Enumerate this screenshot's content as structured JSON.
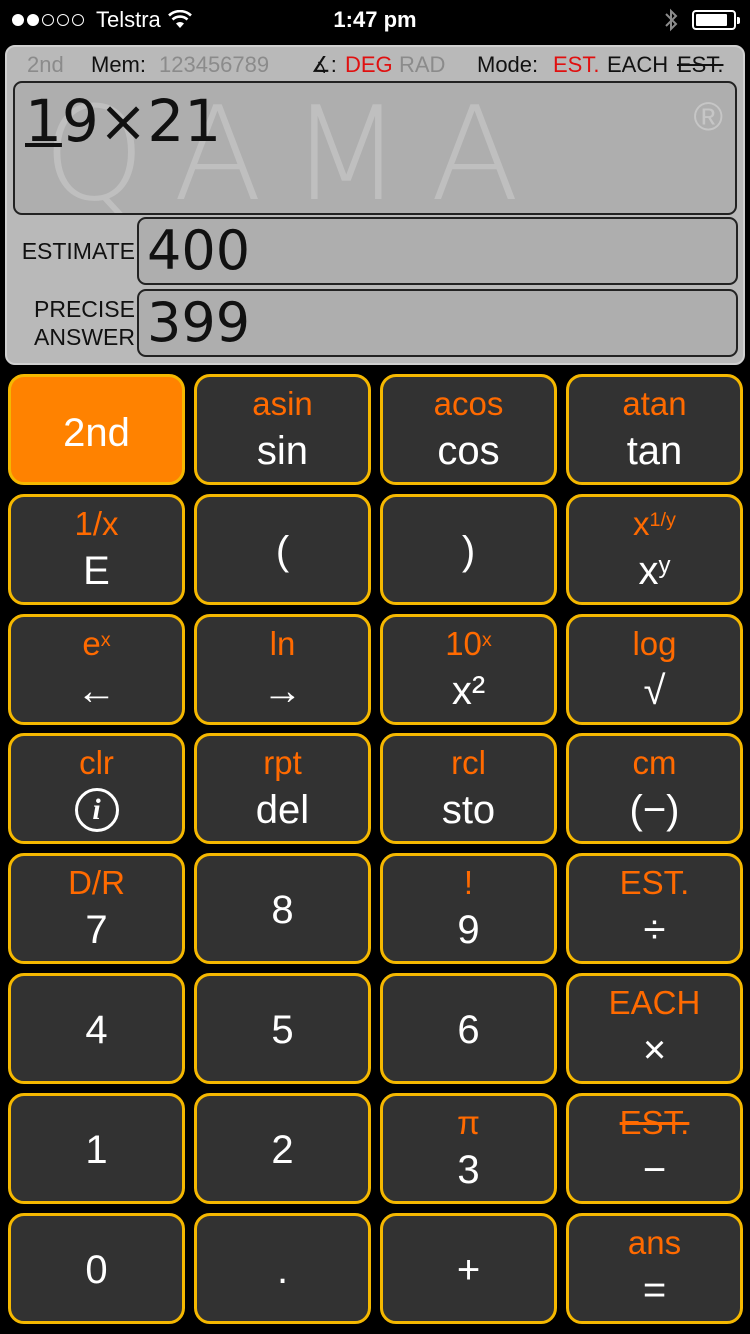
{
  "status_bar": {
    "carrier": "Telstra",
    "signal_dots_filled": 2,
    "signal_dots_total": 5,
    "time": "1:47 pm",
    "battery_level": 0.85
  },
  "info_bar": {
    "second_indicator": "2nd",
    "mem_label": "Mem:",
    "mem_value": "123456789",
    "angle_label": "∡:",
    "angle_deg": "DEG",
    "angle_rad": "RAD",
    "mode_label": "Mode:",
    "mode_est": "EST.",
    "mode_each": "EACH",
    "mode_est_struck": "EST."
  },
  "display": {
    "watermark": "QAMA",
    "watermark_mark": "®",
    "expression_cursor": "1",
    "expression_rest": "9×21",
    "estimate_label": "ESTIMATE",
    "estimate_value": "400",
    "precise_label_1": "PRECISE",
    "precise_label_2": "ANSWER",
    "precise_value": "399"
  },
  "keys": {
    "second": "2nd",
    "sin": {
      "sec": "asin",
      "pri": "sin"
    },
    "cos": {
      "sec": "acos",
      "pri": "cos"
    },
    "tan": {
      "sec": "atan",
      "pri": "tan"
    },
    "e": {
      "sec": "1/x",
      "pri": "E"
    },
    "lparen": "(",
    "rparen": ")",
    "pow": {
      "sec_base": "x",
      "sec_exp": "1/y",
      "pri_base": "x",
      "pri_exp": "y"
    },
    "left": {
      "sec_base": "e",
      "sec_exp": "x",
      "pri": "←"
    },
    "right": {
      "sec": "ln",
      "pri": "→"
    },
    "square": {
      "sec_base": "10",
      "sec_exp": "x",
      "pri": "x²"
    },
    "sqrt": {
      "sec": "log",
      "pri": "√"
    },
    "info": {
      "sec": "clr",
      "pri": "i"
    },
    "del": {
      "sec": "rpt",
      "pri": "del"
    },
    "sto": {
      "sec": "rcl",
      "pri": "sto"
    },
    "neg": {
      "sec": "cm",
      "pri": "(−)"
    },
    "seven": {
      "sec": "D/R",
      "pri": "7"
    },
    "eight": "8",
    "nine": {
      "sec": "!",
      "pri": "9"
    },
    "divide": {
      "sec": "EST.",
      "pri": "÷"
    },
    "four": "4",
    "five": "5",
    "six": "6",
    "multiply": {
      "sec": "EACH",
      "pri": "×"
    },
    "one": "1",
    "two": "2",
    "three": {
      "sec": "π",
      "pri": "3"
    },
    "minus": {
      "sec": "EST.",
      "pri": "−"
    },
    "zero": "0",
    "dot": ".",
    "plus": "+",
    "equals": {
      "sec": "ans",
      "pri": "="
    }
  }
}
